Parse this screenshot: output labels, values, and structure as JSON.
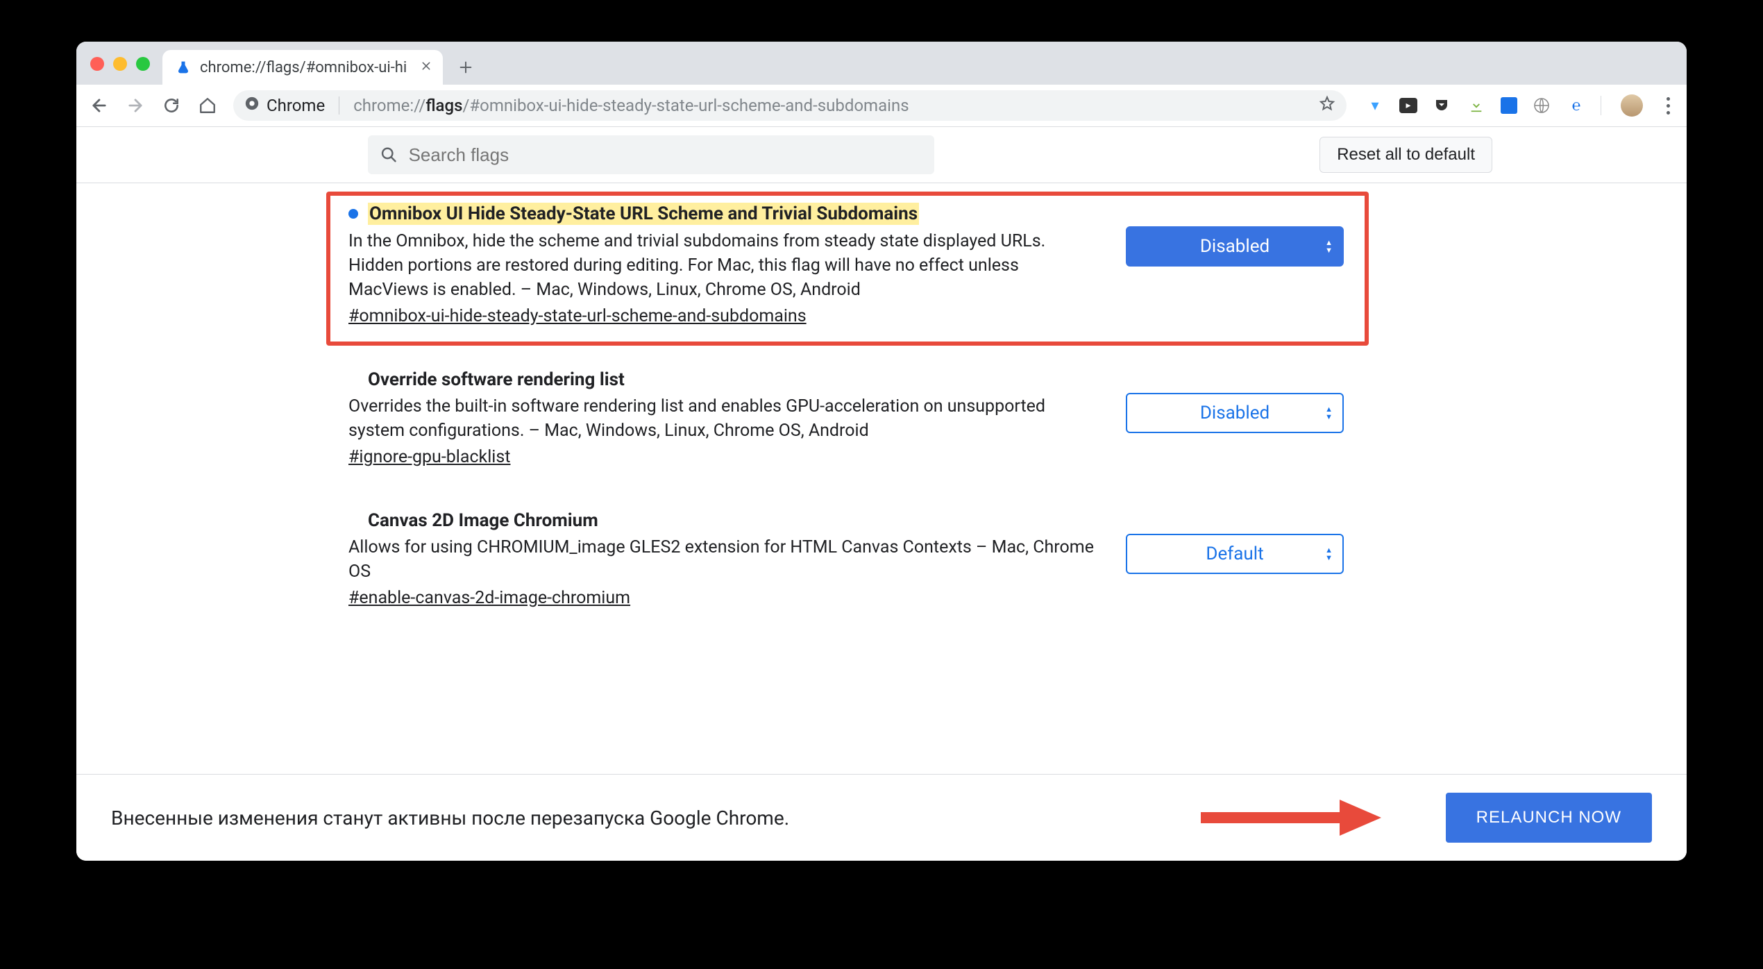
{
  "tab": {
    "title": "chrome://flags/#omnibox-ui-hi"
  },
  "omnibox": {
    "secure_label": "Chrome",
    "url_prefix": "chrome://",
    "url_bold": "flags",
    "url_rest": "/#omnibox-ui-hide-steady-state-url-scheme-and-subdomains"
  },
  "header": {
    "search_placeholder": "Search flags",
    "reset_label": "Reset all to default"
  },
  "flags": [
    {
      "modified": true,
      "title": "Omnibox UI Hide Steady-State URL Scheme and Trivial Subdomains",
      "desc": "In the Omnibox, hide the scheme and trivial subdomains from steady state displayed URLs. Hidden portions are restored during editing. For Mac, this flag will have no effect unless MacViews is enabled. – Mac, Windows, Linux, Chrome OS, Android",
      "anchor": "#omnibox-ui-hide-steady-state-url-scheme-and-subdomains",
      "select": "Disabled",
      "active": true
    },
    {
      "modified": false,
      "title": "Override software rendering list",
      "desc": "Overrides the built-in software rendering list and enables GPU-acceleration on unsupported system configurations. – Mac, Windows, Linux, Chrome OS, Android",
      "anchor": "#ignore-gpu-blacklist",
      "select": "Disabled",
      "active": false
    },
    {
      "modified": false,
      "title": "Canvas 2D Image Chromium",
      "desc": "Allows for using CHROMIUM_image GLES2 extension for HTML Canvas Contexts – Mac, Chrome OS",
      "anchor": "#enable-canvas-2d-image-chromium",
      "select": "Default",
      "active": false
    }
  ],
  "footer": {
    "text": "Внесенные изменения станут активны после перезапуска Google Chrome.",
    "relaunch": "RELAUNCH NOW"
  }
}
